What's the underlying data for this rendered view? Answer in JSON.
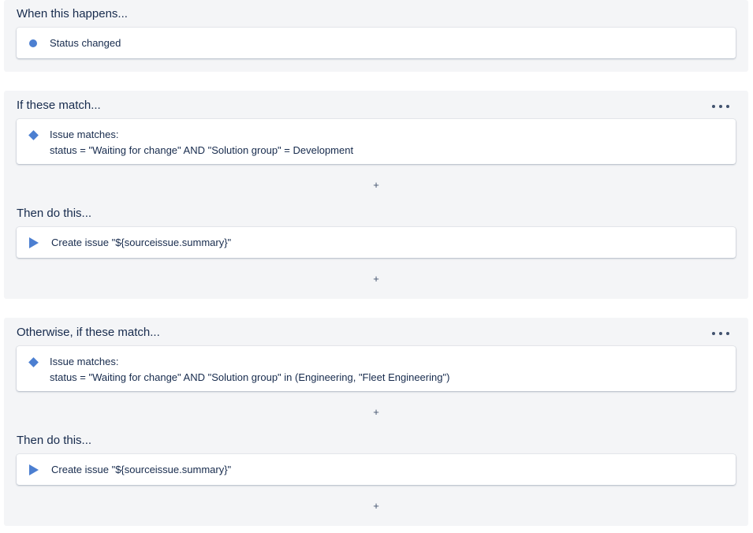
{
  "trigger": {
    "title": "When this happens...",
    "items": [
      {
        "label": "Status changed",
        "icon": "trigger-dot-icon"
      }
    ]
  },
  "if_block": {
    "title": "If these match...",
    "more_icon": "more-horizontal-icon",
    "condition": {
      "icon": "condition-diamond-icon",
      "line1": "Issue matches:",
      "line2": "status = \"Waiting for change\" AND \"Solution group\" = Development"
    },
    "add_condition_label": "+",
    "then_title": "Then do this...",
    "action": {
      "icon": "action-play-icon",
      "label": "Create issue \"${sourceissue.summary}\""
    },
    "add_action_label": "+"
  },
  "else_block": {
    "title": "Otherwise, if these match...",
    "more_icon": "more-horizontal-icon",
    "condition": {
      "icon": "condition-diamond-icon",
      "line1": "Issue matches:",
      "line2": "status = \"Waiting for change\" AND \"Solution group\" in (Engineering, \"Fleet Engineering\")"
    },
    "add_condition_label": "+",
    "then_title": "Then do this...",
    "action": {
      "icon": "action-play-icon",
      "label": "Create issue \"${sourceissue.summary}\""
    },
    "add_action_label": "+"
  },
  "colors": {
    "panel_bg": "#f4f5f7",
    "card_bg": "#ffffff",
    "accent": "#4c7fd1",
    "text": "#172b4d"
  }
}
